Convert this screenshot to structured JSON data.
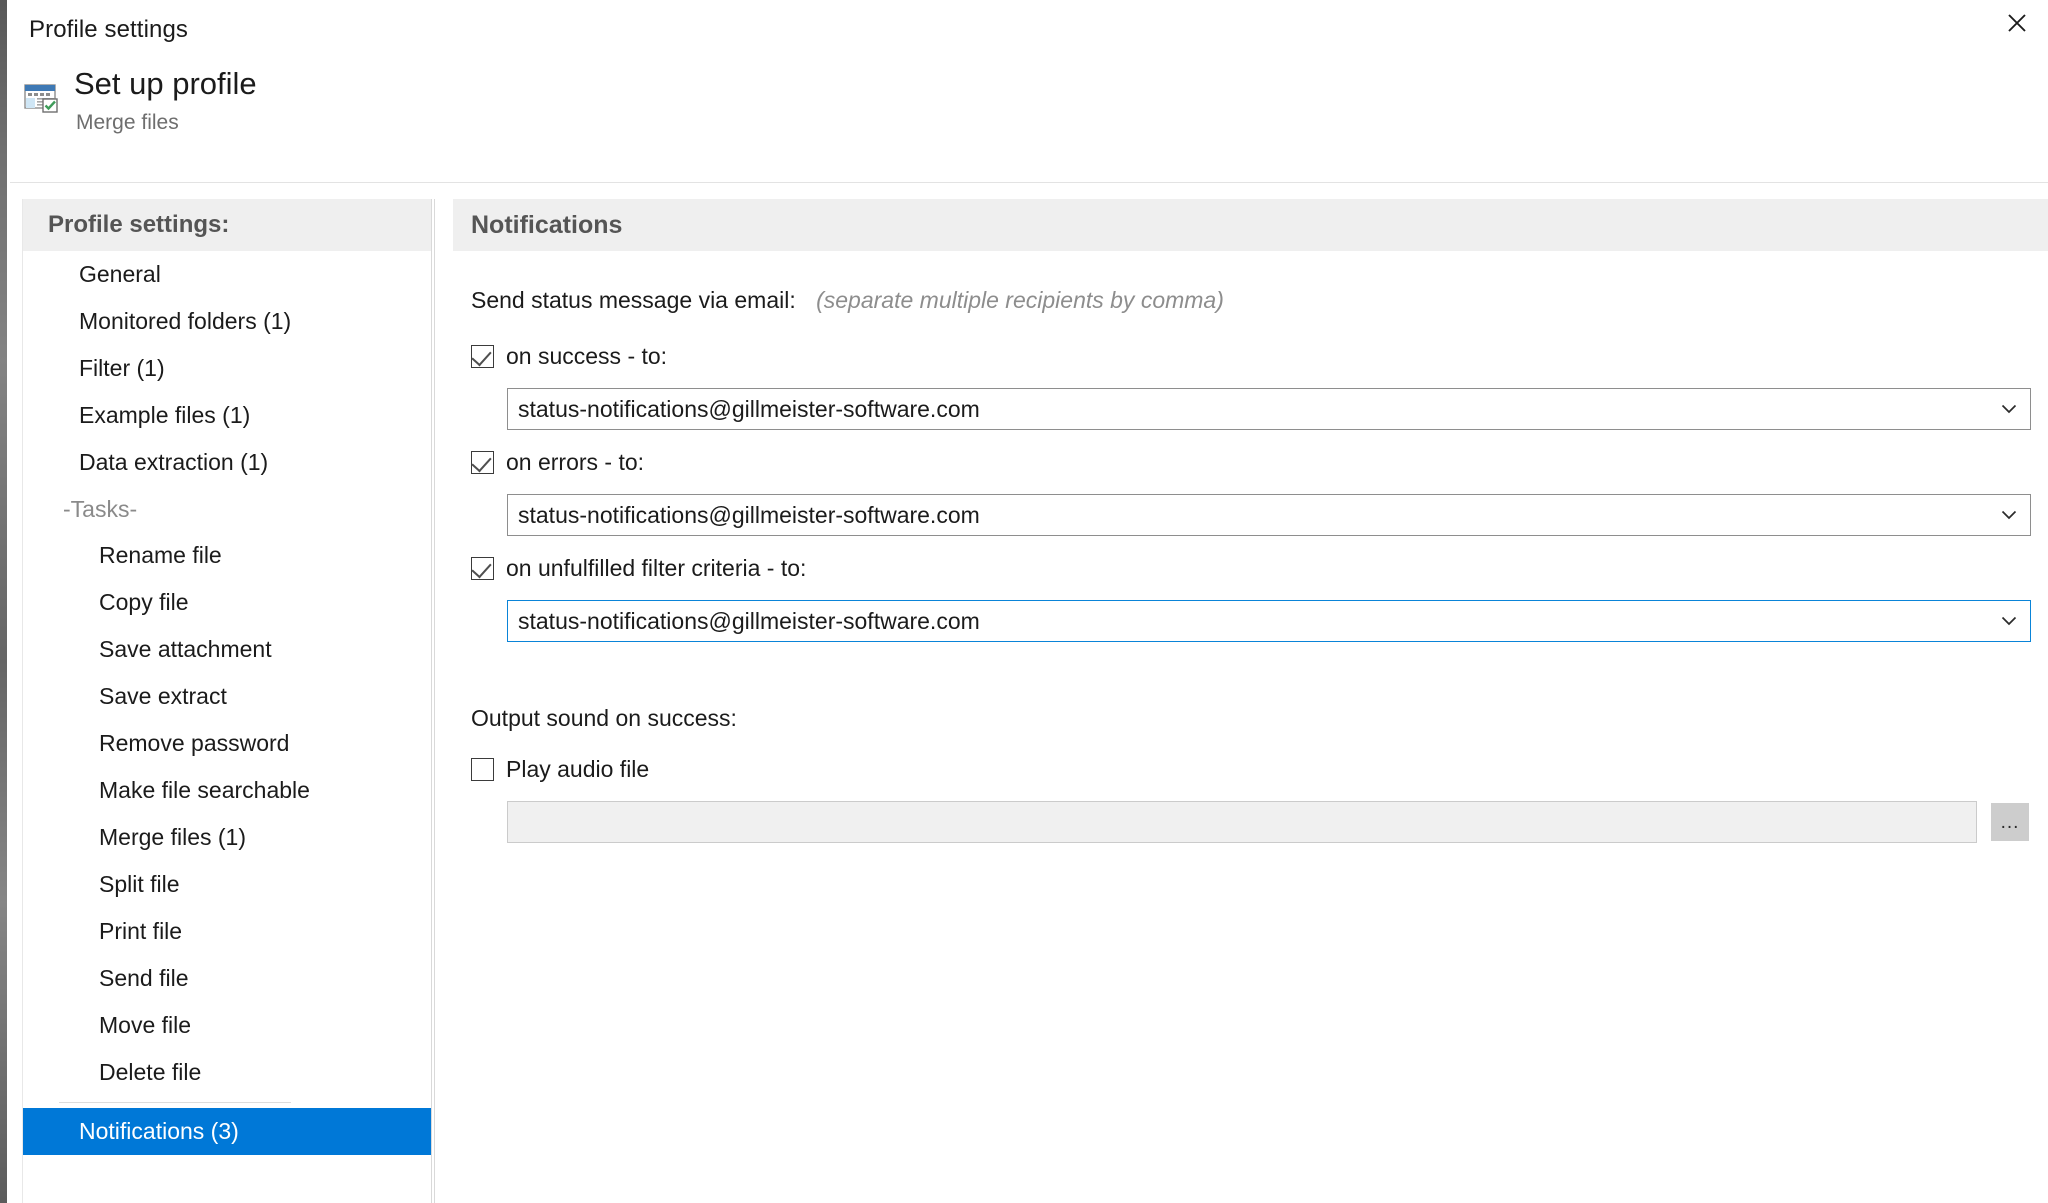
{
  "window": {
    "title": "Profile settings",
    "close_label": "×"
  },
  "header": {
    "icon": "profile-window-icon",
    "title": "Set up profile",
    "subtitle": "Merge files"
  },
  "sidebar": {
    "heading": "Profile settings:",
    "items": [
      {
        "label": "General",
        "level": 1,
        "selected": false
      },
      {
        "label": "Monitored folders (1)",
        "level": 1,
        "selected": false
      },
      {
        "label": "Filter (1)",
        "level": 1,
        "selected": false
      },
      {
        "label": "Example files (1)",
        "level": 1,
        "selected": false
      },
      {
        "label": "Data extraction (1)",
        "level": 1,
        "selected": false
      },
      {
        "label": "-Tasks-",
        "level": 0,
        "selected": false
      },
      {
        "label": "Rename file",
        "level": 2,
        "selected": false
      },
      {
        "label": "Copy file",
        "level": 2,
        "selected": false
      },
      {
        "label": "Save attachment",
        "level": 2,
        "selected": false
      },
      {
        "label": "Save extract",
        "level": 2,
        "selected": false
      },
      {
        "label": "Remove password",
        "level": 2,
        "selected": false
      },
      {
        "label": "Make file searchable",
        "level": 2,
        "selected": false
      },
      {
        "label": "Merge files (1)",
        "level": 2,
        "selected": false
      },
      {
        "label": "Split file",
        "level": 2,
        "selected": false
      },
      {
        "label": "Print file",
        "level": 2,
        "selected": false
      },
      {
        "label": "Send file",
        "level": 2,
        "selected": false
      },
      {
        "label": "Move file",
        "level": 2,
        "selected": false
      },
      {
        "label": "Delete file",
        "level": 2,
        "selected": false
      },
      {
        "label": "Notifications (3)",
        "level": 1,
        "selected": true
      }
    ]
  },
  "main": {
    "heading": "Notifications",
    "email_section": {
      "label": "Send status message via email:",
      "hint": "(separate multiple recipients by comma)",
      "rows": [
        {
          "checkbox_label": "on success - to:",
          "checked": true,
          "value": "status-notifications@gillmeister-software.com",
          "focused": false
        },
        {
          "checkbox_label": "on errors - to:",
          "checked": true,
          "value": "status-notifications@gillmeister-software.com",
          "focused": false
        },
        {
          "checkbox_label": "on unfulfilled filter criteria - to:",
          "checked": true,
          "value": "status-notifications@gillmeister-software.com",
          "focused": true
        }
      ]
    },
    "sound_section": {
      "label": "Output sound on success:",
      "checkbox_label": "Play audio file",
      "checked": false,
      "file_value": "",
      "browse_label": "..."
    }
  },
  "colors": {
    "accent": "#0078d7",
    "focus_border": "#0a84d8",
    "panel_header_bg": "#efefef",
    "header_text": "#555555"
  }
}
